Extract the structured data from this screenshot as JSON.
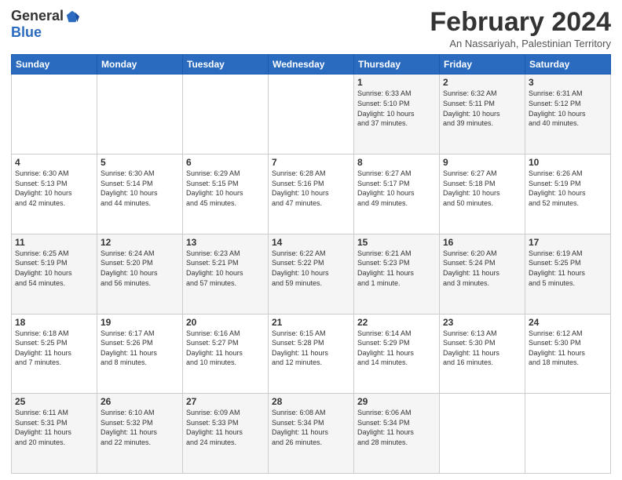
{
  "logo": {
    "general": "General",
    "blue": "Blue"
  },
  "header": {
    "month": "February 2024",
    "location": "An Nassariyah, Palestinian Territory"
  },
  "weekdays": [
    "Sunday",
    "Monday",
    "Tuesday",
    "Wednesday",
    "Thursday",
    "Friday",
    "Saturday"
  ],
  "weeks": [
    [
      {
        "day": "",
        "info": ""
      },
      {
        "day": "",
        "info": ""
      },
      {
        "day": "",
        "info": ""
      },
      {
        "day": "",
        "info": ""
      },
      {
        "day": "1",
        "info": "Sunrise: 6:33 AM\nSunset: 5:10 PM\nDaylight: 10 hours\nand 37 minutes."
      },
      {
        "day": "2",
        "info": "Sunrise: 6:32 AM\nSunset: 5:11 PM\nDaylight: 10 hours\nand 39 minutes."
      },
      {
        "day": "3",
        "info": "Sunrise: 6:31 AM\nSunset: 5:12 PM\nDaylight: 10 hours\nand 40 minutes."
      }
    ],
    [
      {
        "day": "4",
        "info": "Sunrise: 6:30 AM\nSunset: 5:13 PM\nDaylight: 10 hours\nand 42 minutes."
      },
      {
        "day": "5",
        "info": "Sunrise: 6:30 AM\nSunset: 5:14 PM\nDaylight: 10 hours\nand 44 minutes."
      },
      {
        "day": "6",
        "info": "Sunrise: 6:29 AM\nSunset: 5:15 PM\nDaylight: 10 hours\nand 45 minutes."
      },
      {
        "day": "7",
        "info": "Sunrise: 6:28 AM\nSunset: 5:16 PM\nDaylight: 10 hours\nand 47 minutes."
      },
      {
        "day": "8",
        "info": "Sunrise: 6:27 AM\nSunset: 5:17 PM\nDaylight: 10 hours\nand 49 minutes."
      },
      {
        "day": "9",
        "info": "Sunrise: 6:27 AM\nSunset: 5:18 PM\nDaylight: 10 hours\nand 50 minutes."
      },
      {
        "day": "10",
        "info": "Sunrise: 6:26 AM\nSunset: 5:19 PM\nDaylight: 10 hours\nand 52 minutes."
      }
    ],
    [
      {
        "day": "11",
        "info": "Sunrise: 6:25 AM\nSunset: 5:19 PM\nDaylight: 10 hours\nand 54 minutes."
      },
      {
        "day": "12",
        "info": "Sunrise: 6:24 AM\nSunset: 5:20 PM\nDaylight: 10 hours\nand 56 minutes."
      },
      {
        "day": "13",
        "info": "Sunrise: 6:23 AM\nSunset: 5:21 PM\nDaylight: 10 hours\nand 57 minutes."
      },
      {
        "day": "14",
        "info": "Sunrise: 6:22 AM\nSunset: 5:22 PM\nDaylight: 10 hours\nand 59 minutes."
      },
      {
        "day": "15",
        "info": "Sunrise: 6:21 AM\nSunset: 5:23 PM\nDaylight: 11 hours\nand 1 minute."
      },
      {
        "day": "16",
        "info": "Sunrise: 6:20 AM\nSunset: 5:24 PM\nDaylight: 11 hours\nand 3 minutes."
      },
      {
        "day": "17",
        "info": "Sunrise: 6:19 AM\nSunset: 5:25 PM\nDaylight: 11 hours\nand 5 minutes."
      }
    ],
    [
      {
        "day": "18",
        "info": "Sunrise: 6:18 AM\nSunset: 5:25 PM\nDaylight: 11 hours\nand 7 minutes."
      },
      {
        "day": "19",
        "info": "Sunrise: 6:17 AM\nSunset: 5:26 PM\nDaylight: 11 hours\nand 8 minutes."
      },
      {
        "day": "20",
        "info": "Sunrise: 6:16 AM\nSunset: 5:27 PM\nDaylight: 11 hours\nand 10 minutes."
      },
      {
        "day": "21",
        "info": "Sunrise: 6:15 AM\nSunset: 5:28 PM\nDaylight: 11 hours\nand 12 minutes."
      },
      {
        "day": "22",
        "info": "Sunrise: 6:14 AM\nSunset: 5:29 PM\nDaylight: 11 hours\nand 14 minutes."
      },
      {
        "day": "23",
        "info": "Sunrise: 6:13 AM\nSunset: 5:30 PM\nDaylight: 11 hours\nand 16 minutes."
      },
      {
        "day": "24",
        "info": "Sunrise: 6:12 AM\nSunset: 5:30 PM\nDaylight: 11 hours\nand 18 minutes."
      }
    ],
    [
      {
        "day": "25",
        "info": "Sunrise: 6:11 AM\nSunset: 5:31 PM\nDaylight: 11 hours\nand 20 minutes."
      },
      {
        "day": "26",
        "info": "Sunrise: 6:10 AM\nSunset: 5:32 PM\nDaylight: 11 hours\nand 22 minutes."
      },
      {
        "day": "27",
        "info": "Sunrise: 6:09 AM\nSunset: 5:33 PM\nDaylight: 11 hours\nand 24 minutes."
      },
      {
        "day": "28",
        "info": "Sunrise: 6:08 AM\nSunset: 5:34 PM\nDaylight: 11 hours\nand 26 minutes."
      },
      {
        "day": "29",
        "info": "Sunrise: 6:06 AM\nSunset: 5:34 PM\nDaylight: 11 hours\nand 28 minutes."
      },
      {
        "day": "",
        "info": ""
      },
      {
        "day": "",
        "info": ""
      }
    ]
  ]
}
